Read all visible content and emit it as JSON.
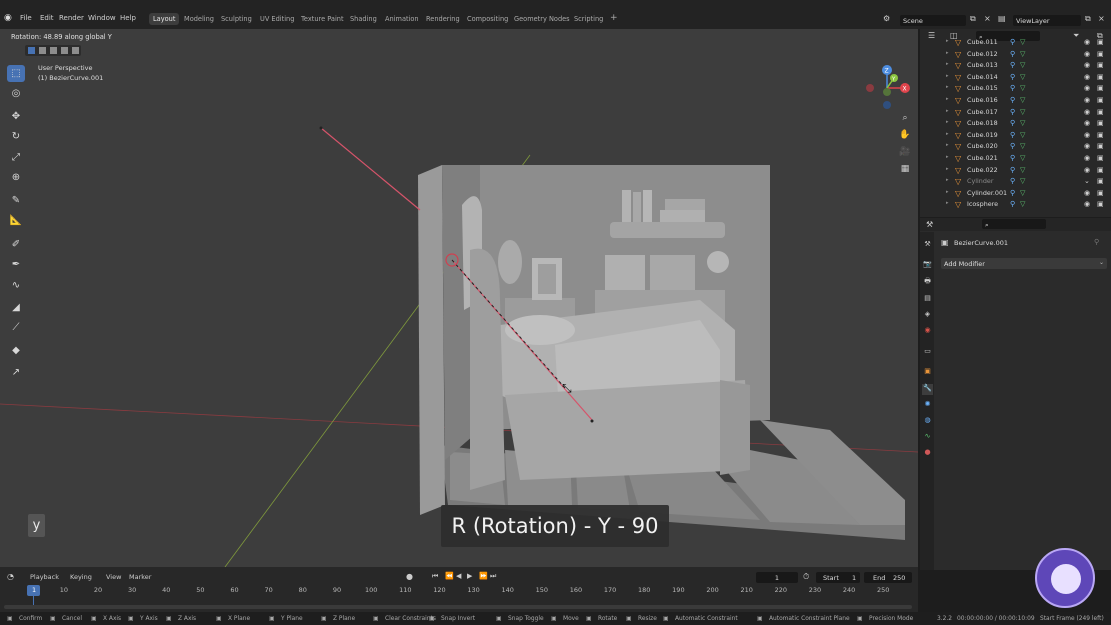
{
  "topbar": {
    "menus": [
      "File",
      "Edit",
      "Render",
      "Window",
      "Help"
    ],
    "workspaces": [
      "Layout",
      "Modeling",
      "Sculpting",
      "UV Editing",
      "Texture Paint",
      "Shading",
      "Animation",
      "Rendering",
      "Compositing",
      "Geometry Nodes",
      "Scripting"
    ],
    "active_workspace": "Layout",
    "add_workspace": "+",
    "scene_label": "Scene",
    "viewlayer_label": "ViewLayer"
  },
  "viewport": {
    "header_text": "Rotation: 48.89 along global Y",
    "perspective": "User Perspective",
    "object_label": "(1) BezierCurve.001",
    "subtitle": "R (Rotation) - Y - 90",
    "key_overlay": "y",
    "gizmo_axes": {
      "x": "X",
      "y": "Y",
      "z": "Z"
    }
  },
  "outliner": {
    "items": [
      {
        "name": "Cube.011",
        "dim": false
      },
      {
        "name": "Cube.012",
        "dim": false
      },
      {
        "name": "Cube.013",
        "dim": false
      },
      {
        "name": "Cube.014",
        "dim": false
      },
      {
        "name": "Cube.015",
        "dim": false
      },
      {
        "name": "Cube.016",
        "dim": false
      },
      {
        "name": "Cube.017",
        "dim": false
      },
      {
        "name": "Cube.018",
        "dim": false
      },
      {
        "name": "Cube.019",
        "dim": false
      },
      {
        "name": "Cube.020",
        "dim": false
      },
      {
        "name": "Cube.021",
        "dim": false
      },
      {
        "name": "Cube.022",
        "dim": false
      },
      {
        "name": "Cylinder",
        "dim": true
      },
      {
        "name": "Cylinder.001",
        "dim": false
      },
      {
        "name": "Icosphere",
        "dim": false
      }
    ]
  },
  "properties": {
    "object_name": "BezierCurve.001",
    "add_modifier": "Add Modifier"
  },
  "timeline": {
    "menus": [
      "Playback",
      "Keying",
      "View",
      "Marker"
    ],
    "current_frame": "1",
    "start_label": "Start",
    "start_value": "1",
    "end_label": "End",
    "end_value": "250",
    "ticks": [
      "1",
      "10",
      "20",
      "30",
      "40",
      "50",
      "60",
      "70",
      "80",
      "90",
      "100",
      "110",
      "120",
      "130",
      "140",
      "150",
      "160",
      "170",
      "180",
      "190",
      "200",
      "210",
      "220",
      "230",
      "240",
      "250"
    ]
  },
  "statusbar": {
    "items": [
      "Confirm",
      "Cancel",
      "X Axis",
      "Y Axis",
      "Z Axis",
      "X Plane",
      "Y Plane",
      "Z Plane",
      "Clear Constraints",
      "Snap Invert",
      "Snap Toggle",
      "Move",
      "Rotate",
      "Resize",
      "Automatic Constraint",
      "Automatic Constraint Plane",
      "Precision Mode"
    ],
    "keys": [
      "X",
      "Y",
      "Z",
      "⇧X",
      "⇧Y",
      "⇧Z"
    ],
    "version": "3.2.2",
    "time_info": "00:00:00:00 / 00:00:10:09",
    "frame_info": "Start Frame (249 left)"
  },
  "colors": {
    "accent": "#4772b3",
    "x_axis": "#e0444c",
    "y_axis": "#8cc63f",
    "z_axis": "#4d8de0"
  }
}
